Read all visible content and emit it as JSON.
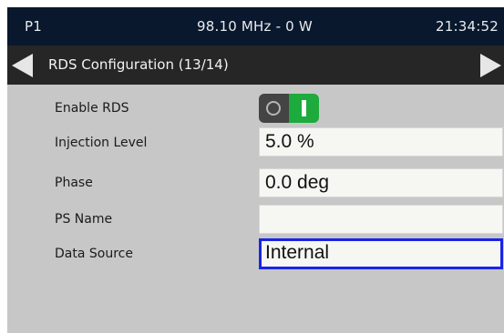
{
  "status_bar": {
    "preset": "P1",
    "frequency_power": "98.10 MHz - 0 W",
    "time": "21:34:52"
  },
  "title_bar": {
    "title": "RDS Configuration (13/14)",
    "prev_icon": "arrow-left-icon",
    "next_icon": "arrow-right-icon"
  },
  "settings": {
    "enable_rds": {
      "label": "Enable RDS",
      "state": "on"
    },
    "injection_level": {
      "label": "Injection Level",
      "value": "5.0 %"
    },
    "phase": {
      "label": "Phase",
      "value": "0.0 deg"
    },
    "ps_name": {
      "label": "PS Name",
      "value": ""
    },
    "data_source": {
      "label": "Data Source",
      "value": "Internal"
    }
  },
  "colors": {
    "status_bar_bg": "#09182d",
    "title_bar_bg": "#262626",
    "panel_bg": "#c7c7c7",
    "toggle_on": "#1cab3c",
    "selection_border": "#1a24e6"
  }
}
